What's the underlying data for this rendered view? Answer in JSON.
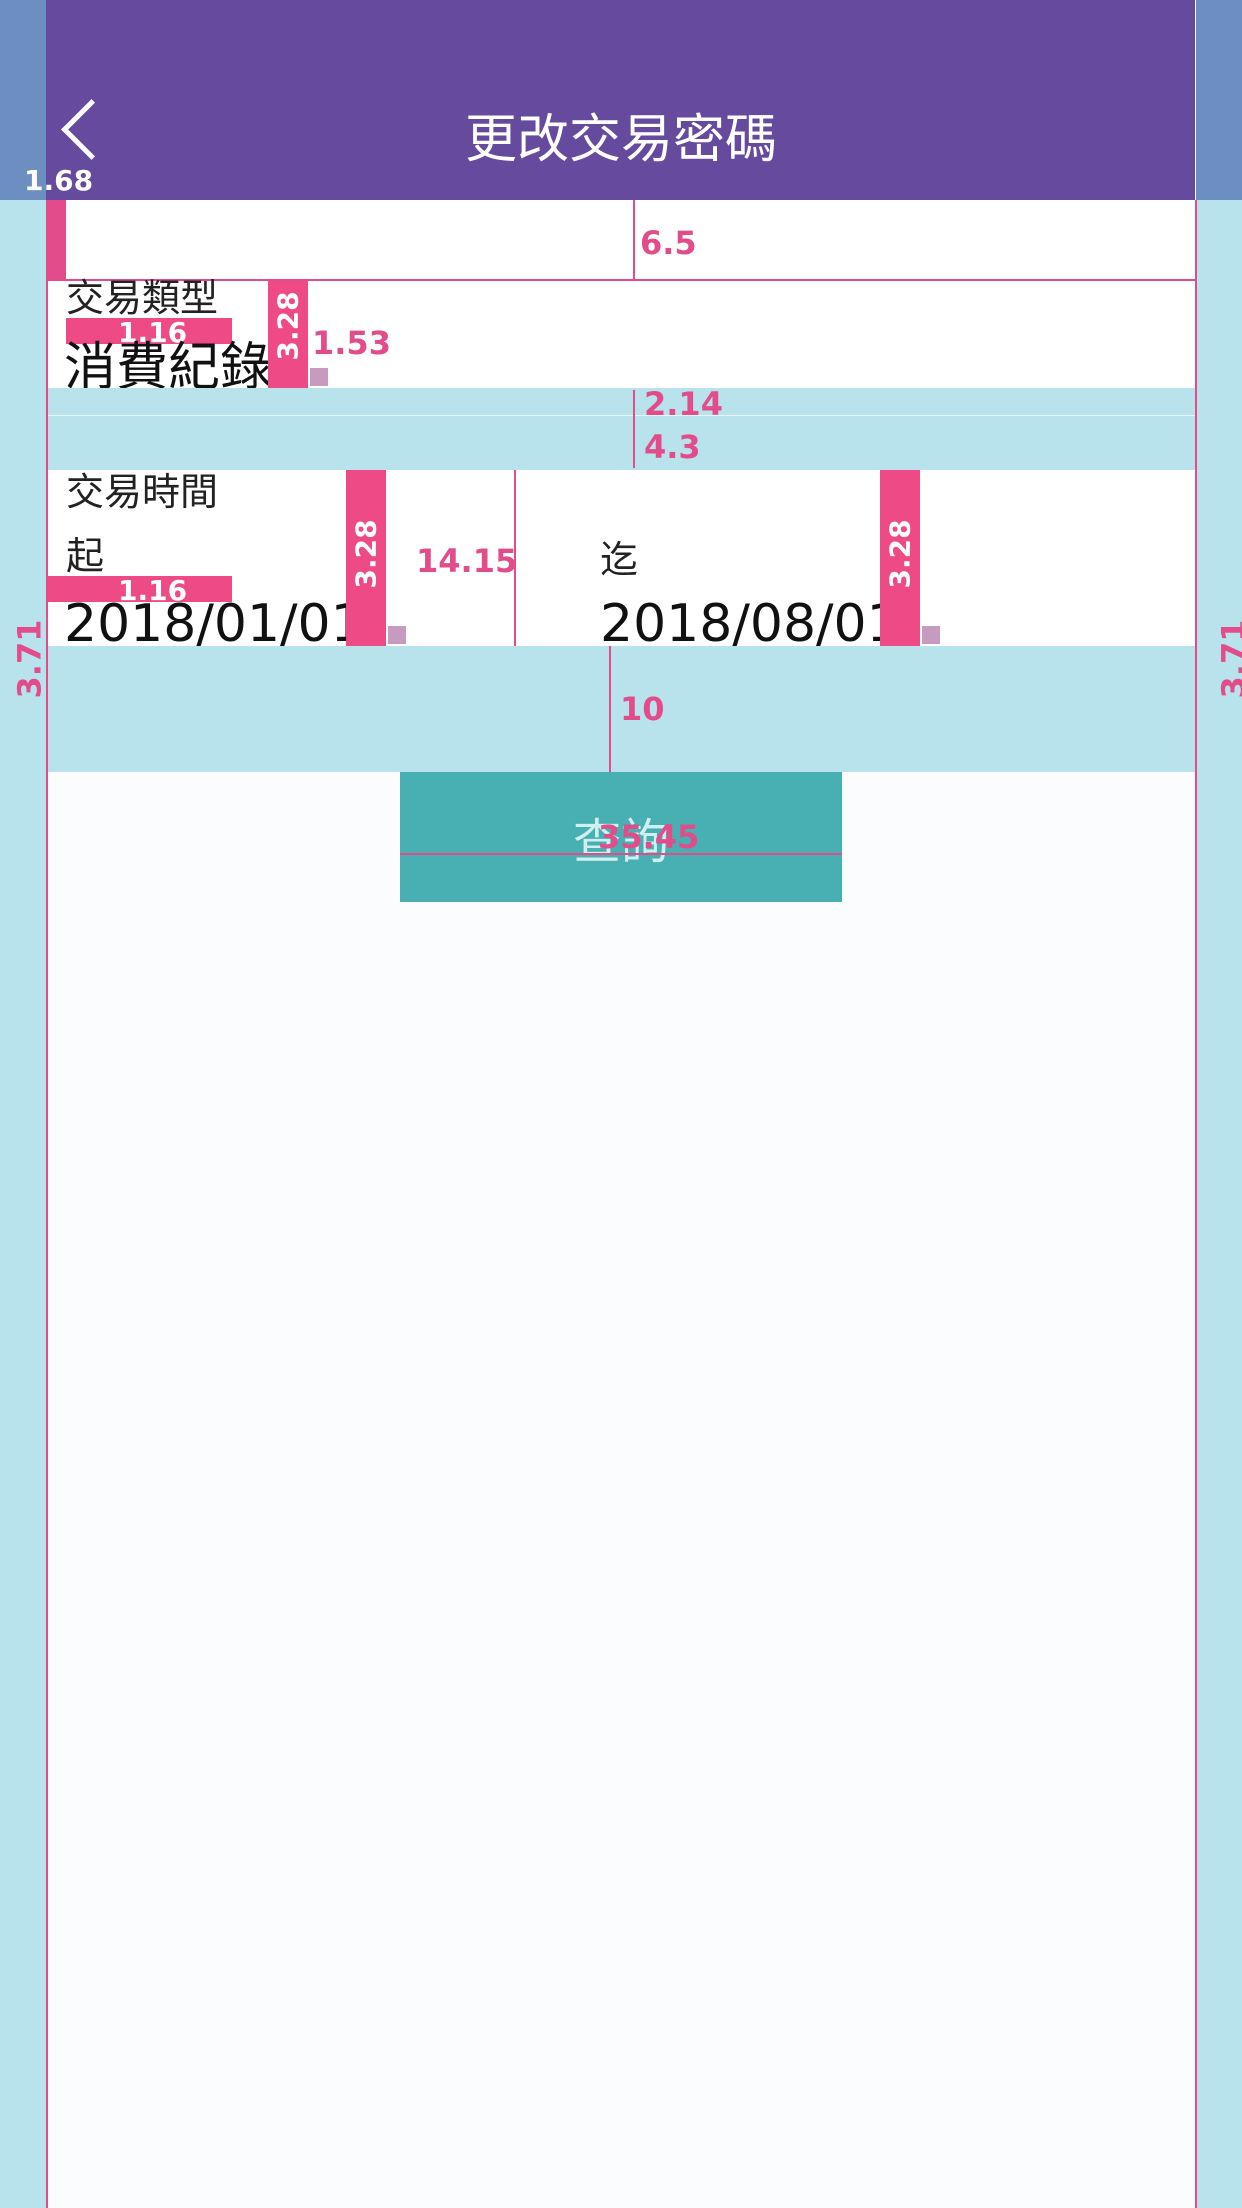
{
  "header": {
    "title": "更改交易密碼",
    "back_icon": "chevron-left-icon"
  },
  "form": {
    "type_label": "交易類型",
    "type_value": "消費紀錄",
    "time_label": "交易時間",
    "start_label": "起",
    "start_value": "2018/01/01",
    "end_label": "迄",
    "end_value": "2018/08/01"
  },
  "actions": {
    "query_label": "查詢"
  },
  "annotations": {
    "status_height": "1.68",
    "top_gap": "6.5",
    "text_gap_1": "1.16",
    "field_height_1": "3.28",
    "value_gap": "1.53",
    "divider_1": "2.14",
    "divider_2": "4.3",
    "text_gap_2": "1.16",
    "field_height_2": "3.28",
    "row_height": "14.15",
    "field_height_3": "3.28",
    "button_gap": "10",
    "button_width": "35.45",
    "side_margin_left": "3.71",
    "side_margin_right": "3.71"
  },
  "colors": {
    "header": "#664a9e",
    "accent": "#48b0b2",
    "spacer": "#b9e3ec",
    "annotation": "#e24c8a"
  }
}
